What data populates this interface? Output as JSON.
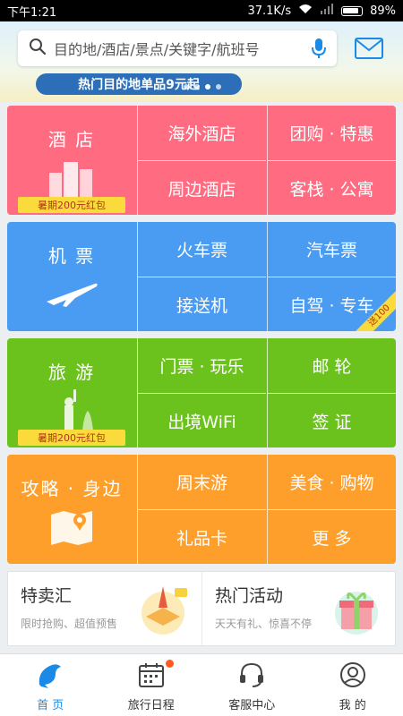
{
  "status_bar": {
    "time": "下午1:21",
    "speed": "37.1K/s",
    "battery": "89%"
  },
  "search": {
    "placeholder": "目的地/酒店/景点/关键字/航班号"
  },
  "banner": {
    "text": "热门目的地单品9元起"
  },
  "sections": [
    {
      "name": "酒 店",
      "badge": "暑期200元红包",
      "items": [
        "海外酒店",
        "团购 · 特惠",
        "周边酒店",
        "客栈 · 公寓"
      ],
      "color": "#ff6b81"
    },
    {
      "name": "机 票",
      "items": [
        "火车票",
        "汽车票",
        "接送机",
        "自驾 · 专车"
      ],
      "ribbon": "送100",
      "color": "#4a9bf2"
    },
    {
      "name": "旅 游",
      "badge": "暑期200元红包",
      "items": [
        "门票 · 玩乐",
        "邮 轮",
        "出境WiFi",
        "签 证"
      ],
      "color": "#6cc21c"
    },
    {
      "name": "攻略 · 身边",
      "items": [
        "周末游",
        "美食 · 购物",
        "礼品卡",
        "更 多"
      ],
      "color": "#ff9f2b"
    }
  ],
  "promos": [
    {
      "title": "特卖汇",
      "subtitle": "限时抢购、超值预售",
      "icon": "eiffel-tower-box-icon"
    },
    {
      "title": "热门活动",
      "subtitle": "天天有礼、惊喜不停",
      "icon": "gift-box-icon"
    }
  ],
  "tabs": [
    {
      "label": "首 页",
      "icon": "dolphin-home-icon"
    },
    {
      "label": "旅行日程",
      "icon": "calendar-icon"
    },
    {
      "label": "客服中心",
      "icon": "headset-icon"
    },
    {
      "label": "我 的",
      "icon": "user-icon"
    }
  ]
}
